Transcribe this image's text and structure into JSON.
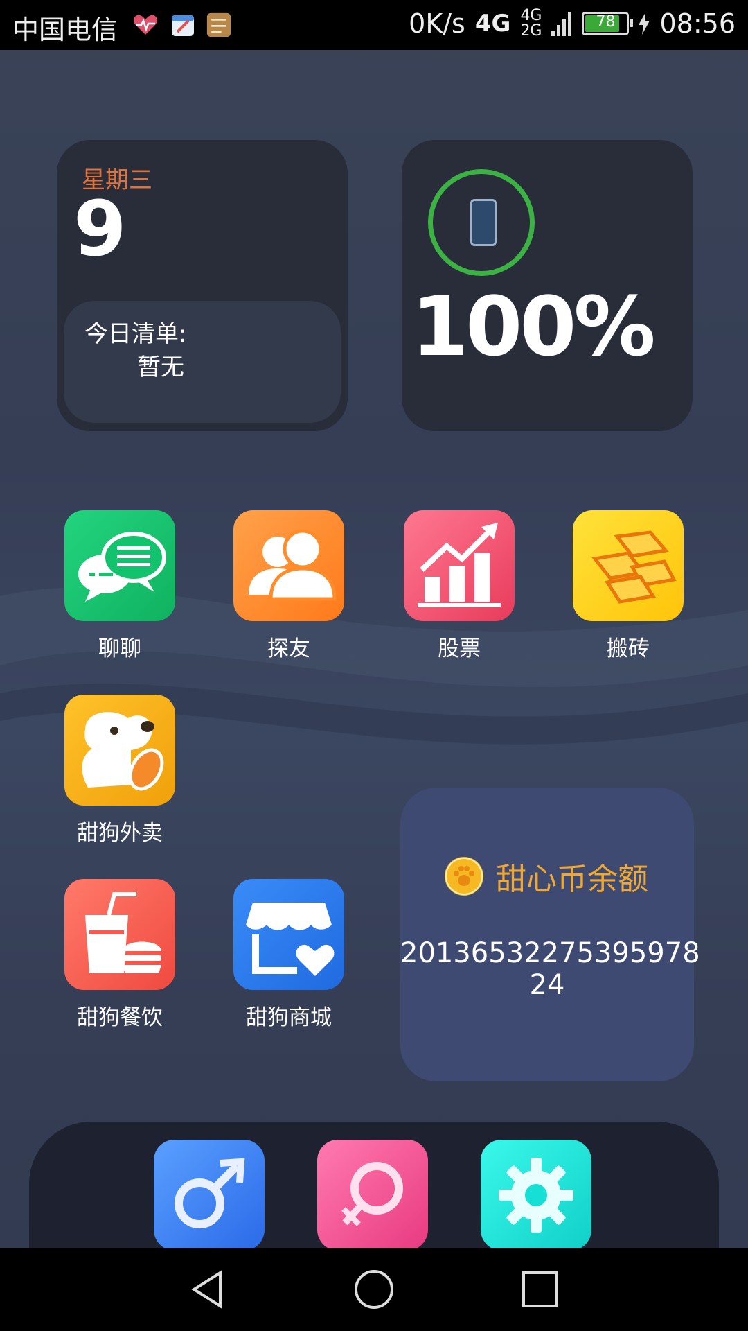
{
  "status_bar": {
    "carrier": "中国电信",
    "net_speed": "0K/s",
    "network_type": "4G",
    "network_small_top": "4G",
    "network_small_bottom": "2G",
    "battery_level": "78",
    "time": "08:56",
    "notification_icons": [
      "heart-rate-icon",
      "calendar-app-icon",
      "notes-app-icon"
    ]
  },
  "date_widget": {
    "weekday": "星期三",
    "day": "9",
    "todo_title": "今日清单:",
    "todo_value": "暂无"
  },
  "battery_widget": {
    "percent": "100%",
    "ring_color": "#3cb245"
  },
  "apps": [
    {
      "label": "聊聊",
      "icon": "chat-bubbles-icon",
      "color": "#13c26d"
    },
    {
      "label": "探友",
      "icon": "friends-icon",
      "color": "#ff8c2a"
    },
    {
      "label": "股票",
      "icon": "stock-chart-icon",
      "color": "#f2506a"
    },
    {
      "label": "搬砖",
      "icon": "gold-bars-icon",
      "color": "#ffd21a"
    },
    {
      "label": "甜狗外卖",
      "icon": "dog-icon",
      "color": "#f8b21a"
    },
    {
      "label": "甜狗餐饮",
      "icon": "drink-burger-icon",
      "color": "#f85a50"
    },
    {
      "label": "甜狗商城",
      "icon": "shop-heart-icon",
      "color": "#2a7bf0"
    }
  ],
  "coin_widget": {
    "title": "甜心币余额",
    "balance": "20136532275395978​24"
  },
  "dock": [
    {
      "icon": "male-icon",
      "color": "#3b82f0"
    },
    {
      "icon": "female-icon",
      "color": "#f0508a"
    },
    {
      "icon": "settings-gear-icon",
      "color": "#16e0d6"
    }
  ],
  "nav_bar": [
    "back-icon",
    "home-icon",
    "recents-icon"
  ]
}
